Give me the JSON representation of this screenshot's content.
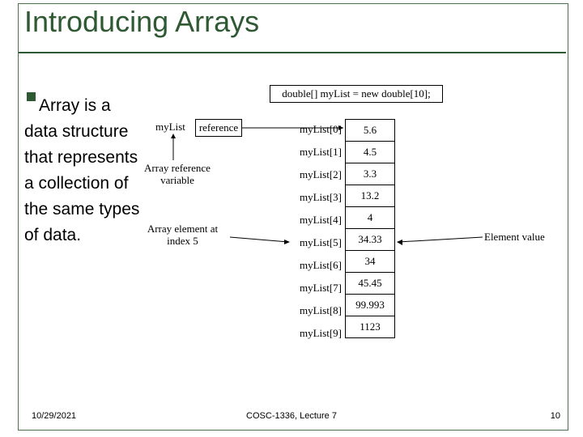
{
  "title": "Introducing Arrays",
  "body": "Array is a data structure that represents a collection of the same types of data.",
  "footer": {
    "date": "10/29/2021",
    "center": "COSC-1336, Lecture 7",
    "page": "10"
  },
  "diagram": {
    "declaration": "double[] myList = new double[10];",
    "ref_var": "myList",
    "ref_box": "reference",
    "array_ref_var_label": "Array reference variable",
    "array_elem_label": "Array element at index 5",
    "element_value_label": "Element value",
    "indices": [
      "myList[0]",
      "myList[1]",
      "myList[2]",
      "myList[3]",
      "myList[4]",
      "myList[5]",
      "myList[6]",
      "myList[7]",
      "myList[8]",
      "myList[9]"
    ],
    "values": [
      "5.6",
      "4.5",
      "3.3",
      "13.2",
      "4",
      "34.33",
      "34",
      "45.45",
      "99.993",
      "1123"
    ]
  }
}
